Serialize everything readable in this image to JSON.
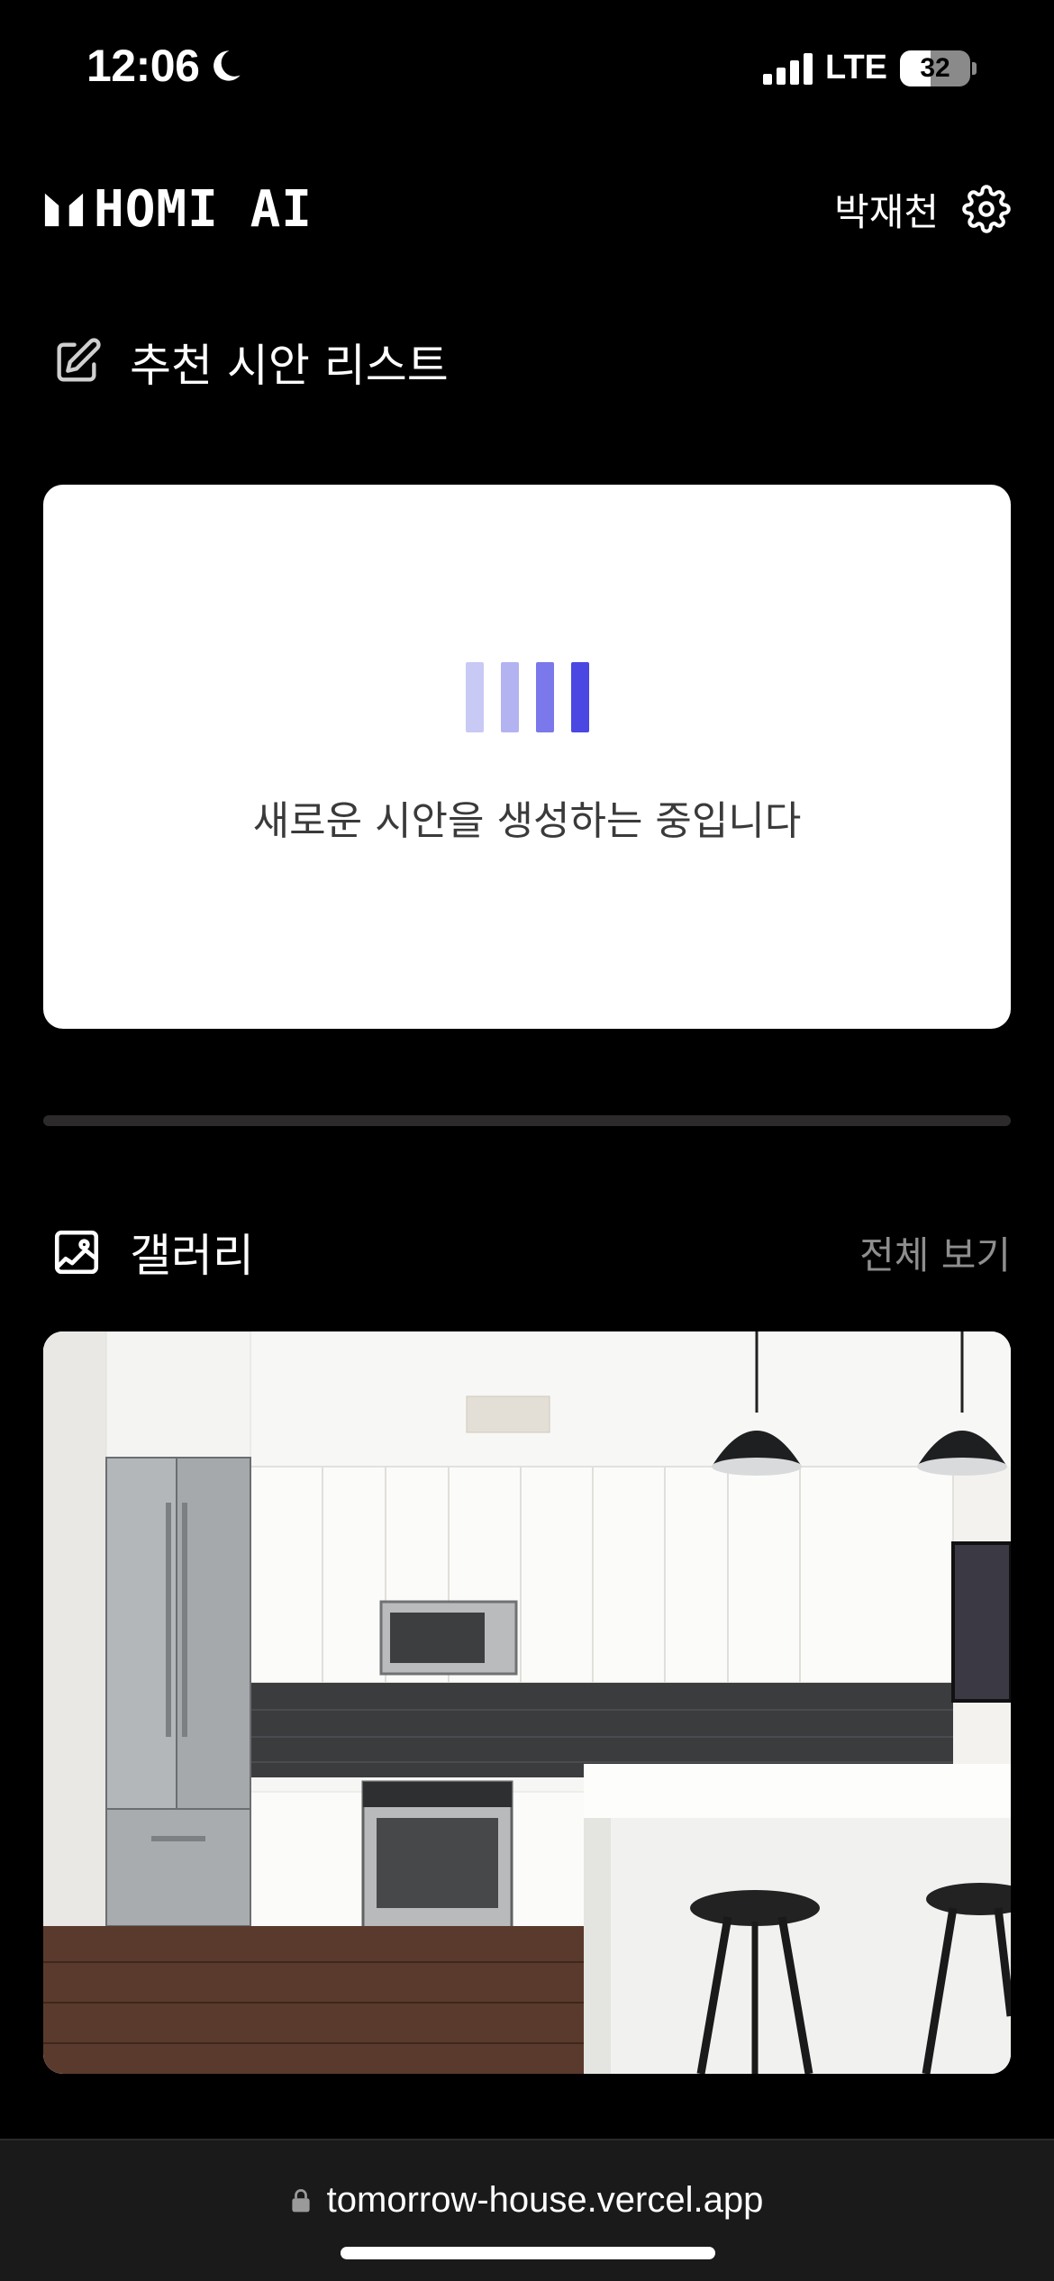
{
  "status_bar": {
    "time": "12:06",
    "network": "LTE",
    "battery": "32",
    "icons": [
      "moon-icon",
      "signal-icon",
      "battery-icon"
    ]
  },
  "header": {
    "logo_text": "HOMI AI",
    "user_name": "박재천",
    "icons": [
      "logo-mark-icon",
      "gear-icon"
    ]
  },
  "recommend": {
    "title": "추천 시안 리스트",
    "icon": "edit-icon",
    "loading_text": "새로운 시안을 생성하는 중입니다",
    "loader_colors": [
      "#c9c9f5",
      "#b3b3f2",
      "#7a78ea",
      "#4a47e3"
    ]
  },
  "gallery": {
    "title": "갤러리",
    "icon": "image-icon",
    "view_all": "전체 보기",
    "image_subject": "kitchen-photo"
  },
  "browser": {
    "url": "tomorrow-house.vercel.app",
    "icon": "lock-icon"
  },
  "colors": {
    "background": "#000000",
    "accent": "#4a47e3",
    "muted": "#8e8e8e"
  }
}
